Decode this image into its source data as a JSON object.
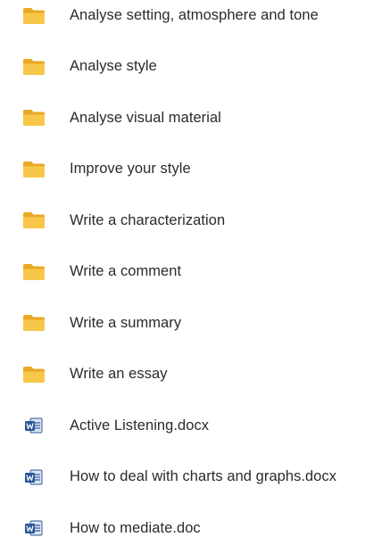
{
  "items": [
    {
      "name": "Analyse setting, atmosphere and tone",
      "type": "folder",
      "icon": "folder-icon"
    },
    {
      "name": "Analyse style",
      "type": "folder",
      "icon": "folder-icon"
    },
    {
      "name": "Analyse visual material",
      "type": "folder",
      "icon": "folder-icon"
    },
    {
      "name": "Improve your style",
      "type": "folder",
      "icon": "folder-icon"
    },
    {
      "name": "Write a characterization",
      "type": "folder",
      "icon": "folder-icon"
    },
    {
      "name": "Write a comment",
      "type": "folder",
      "icon": "folder-icon"
    },
    {
      "name": "Write a summary",
      "type": "folder",
      "icon": "folder-icon"
    },
    {
      "name": "Write an essay",
      "type": "folder",
      "icon": "folder-icon"
    },
    {
      "name": "Active Listening.docx",
      "type": "word",
      "icon": "word-document-icon"
    },
    {
      "name": "How to deal with charts and graphs.docx",
      "type": "word",
      "icon": "word-document-icon"
    },
    {
      "name": "How to mediate.doc",
      "type": "word",
      "icon": "word-document-icon"
    }
  ],
  "colors": {
    "folder": "#F8C74A",
    "folder_back": "#E9A825",
    "word_blue": "#2B579A",
    "word_page": "#DCE6F4"
  }
}
